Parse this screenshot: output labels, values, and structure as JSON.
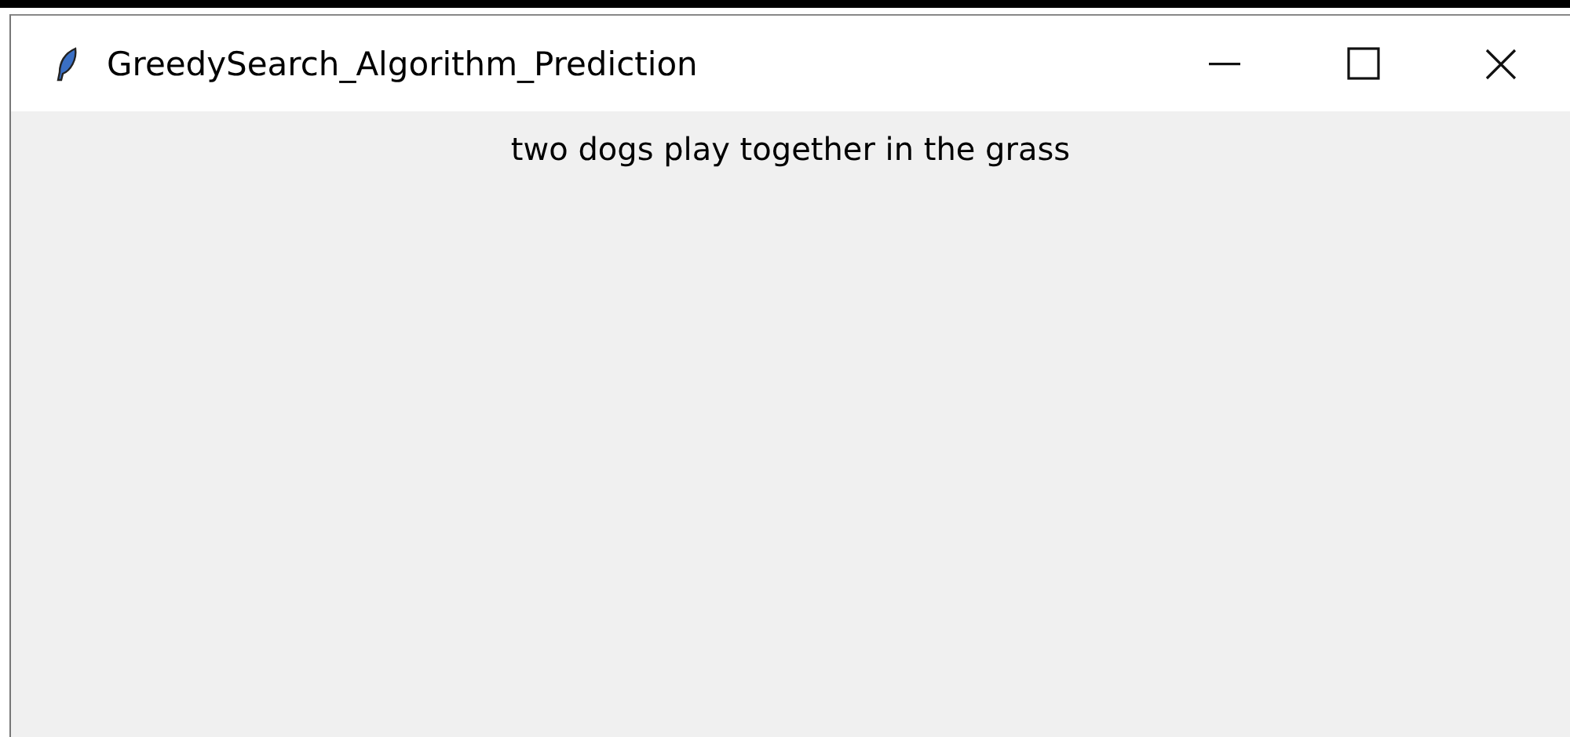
{
  "window": {
    "title": "GreedySearch_Algorithm_Prediction"
  },
  "label": {
    "text": "two dogs play together in the grass"
  }
}
